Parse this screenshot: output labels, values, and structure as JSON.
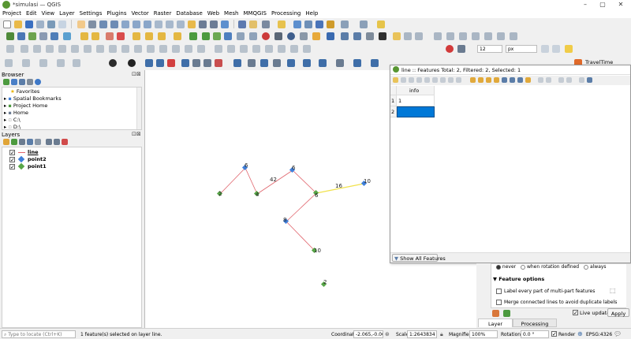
{
  "window": {
    "title": "*simulasi — QGIS"
  },
  "menu": [
    "Project",
    "Edit",
    "View",
    "Layer",
    "Settings",
    "Plugins",
    "Vector",
    "Raster",
    "Database",
    "Web",
    "Mesh",
    "MMQGIS",
    "Processing",
    "Help"
  ],
  "toolbar": {
    "size_value": "12",
    "unit_value": "px",
    "traveltime_label": "TravelTime"
  },
  "browser": {
    "title": "Browser",
    "items": [
      "Favorites",
      "Spatial Bookmarks",
      "Project Home",
      "Home",
      "C:\\",
      "D:\\"
    ]
  },
  "layers": {
    "title": "Layers",
    "items": [
      "line",
      "point2",
      "point1"
    ]
  },
  "attr": {
    "title": "line :: Features Total: 2, Filtered: 2, Selected: 1",
    "column": "info",
    "rows": [
      {
        "num": "1",
        "value": "1"
      },
      {
        "num": "2",
        "value": ""
      }
    ],
    "show_all": "Show All Features"
  },
  "label_panel": {
    "never": "never",
    "when_rotation": "when rotation defined",
    "always": "always",
    "feature_options": "Feature options",
    "opt1": "Label every part of multi-part features",
    "opt2": "Merge connected lines to avoid duplicate labels",
    "live_update": "Live update",
    "apply": "Apply",
    "tab_styling": "Layer Styling",
    "tab_processing": "Processing Toolbox"
  },
  "map_labels": {
    "p6a": "6",
    "p2a": "2",
    "p4": "4",
    "p42": "42",
    "p6b": "6",
    "p6c": "6",
    "p16": "16",
    "p10a": "10",
    "p8": "8",
    "p10b": "10",
    "p2b": "2"
  },
  "status": {
    "locate_placeholder": "Type to locate (Ctrl+K)",
    "message": "1 feature(s) selected on layer line.",
    "coord_label": "Coordinate",
    "coord_value": "-2.065,-0.000",
    "scale_label": "Scale",
    "scale_value": "1:2643834",
    "magnifier_label": "Magnifier",
    "magnifier_value": "100%",
    "rotation_label": "Rotation",
    "rotation_value": "0.0 °",
    "render_label": "Render",
    "crs": "EPSG:4326"
  },
  "colors": {
    "accent": "#0078d7",
    "selected_cell": "#0078d7",
    "line_red": "#e0636b",
    "line_selected": "#f1e24d",
    "point_green": "#57a547",
    "point_blue": "#3f7fd9"
  }
}
